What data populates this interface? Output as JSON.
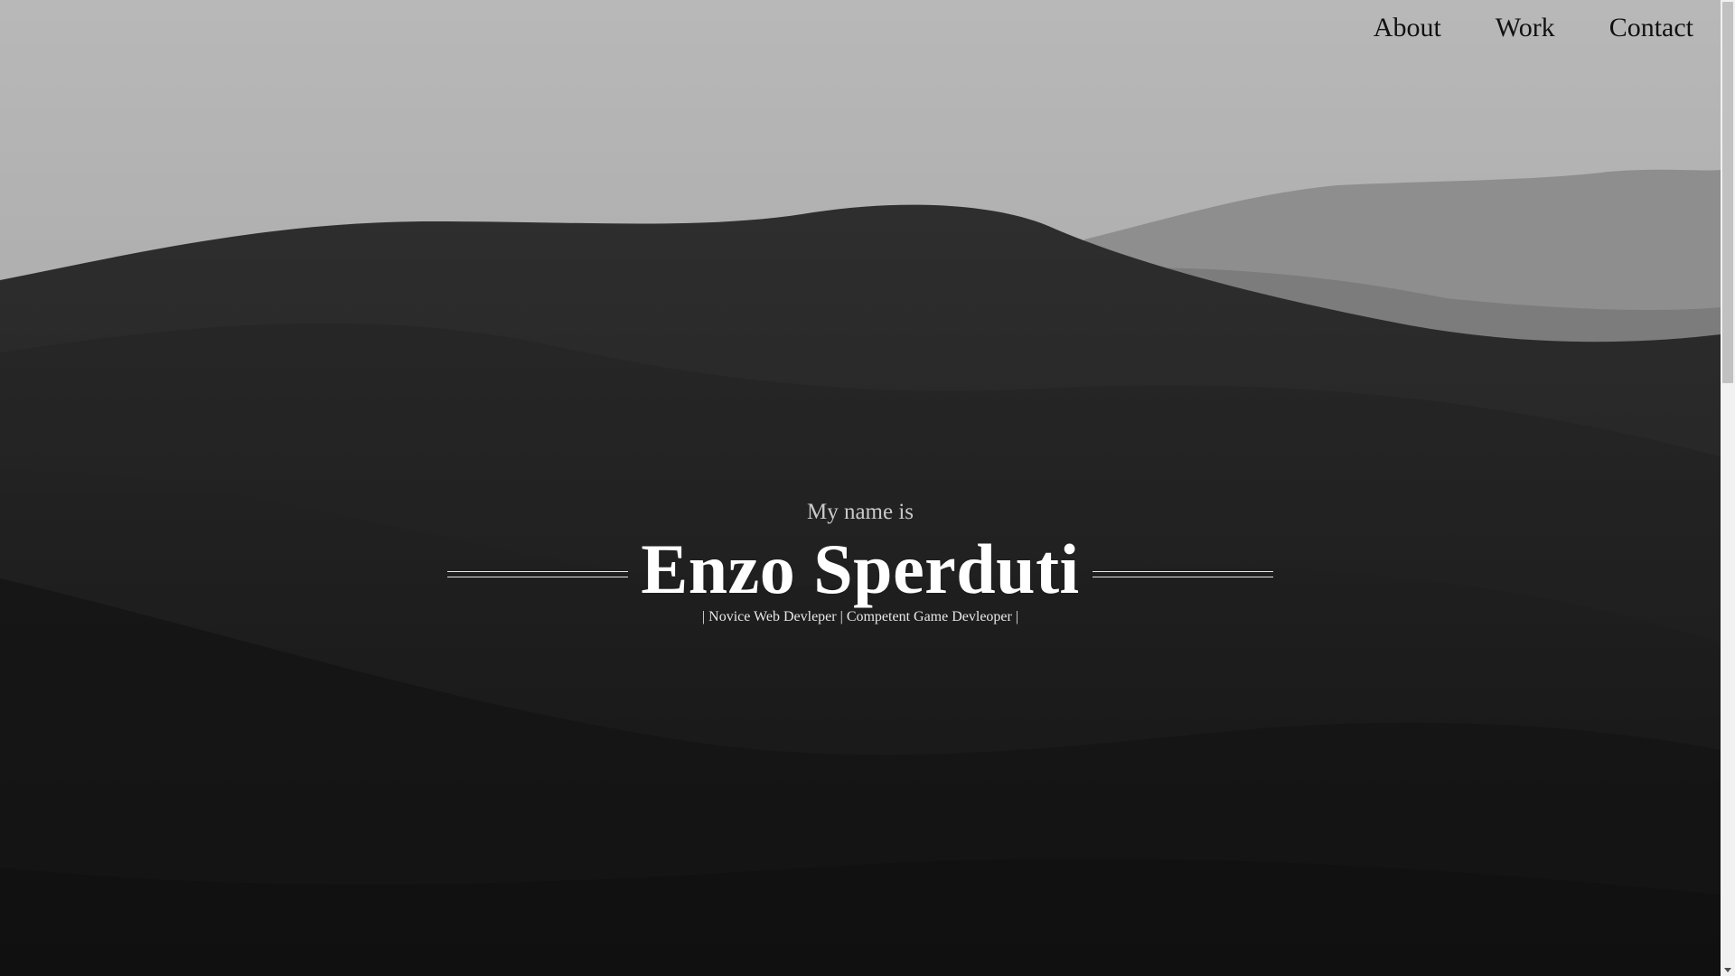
{
  "nav": {
    "items": [
      {
        "label": "About"
      },
      {
        "label": "Work"
      },
      {
        "label": "Contact"
      }
    ]
  },
  "hero": {
    "intro": "My name is",
    "name": "Enzo Sperduti",
    "tagline": "| Novice Web Devleper | Competent Game Devleoper |"
  },
  "colors": {
    "sky": "#b6b6b6",
    "dunes": "#1c1c1c",
    "name_text": "#ffffff",
    "nav_text": "#111111"
  }
}
